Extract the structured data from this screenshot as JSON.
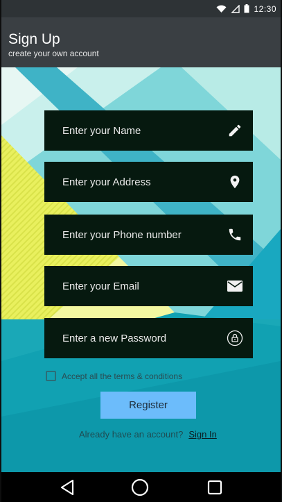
{
  "status_bar": {
    "time": "12:30",
    "icons": [
      "wifi-icon",
      "signal-icon",
      "battery-icon"
    ]
  },
  "app_bar": {
    "title": "Sign Up",
    "subtitle": "create your own account"
  },
  "form": {
    "name": {
      "placeholder": "Enter your Name",
      "icon": "pencil-icon"
    },
    "address": {
      "placeholder": "Enter your Address",
      "icon": "location-pin-icon"
    },
    "phone": {
      "placeholder": "Enter your Phone number",
      "icon": "phone-icon"
    },
    "email": {
      "placeholder": "Enter your Email",
      "icon": "envelope-icon"
    },
    "password": {
      "placeholder": "Enter a new Password",
      "icon": "lock-icon"
    },
    "terms_label": "Accept all the terms & conditions",
    "terms_checked": false,
    "register_label": "Register",
    "signin_prompt": "Already have an account?",
    "signin_link": "Sign In"
  },
  "nav_bar": {
    "buttons": [
      "back-icon",
      "home-icon",
      "recent-apps-icon"
    ]
  },
  "colors": {
    "status_bar": "#2e3336",
    "app_bar": "#3a3f43",
    "field_bg": "#06190f",
    "register_button": "#6cbcfb",
    "background_teal": "#1aa8b7",
    "background_yellow": "#e6ef5a"
  }
}
